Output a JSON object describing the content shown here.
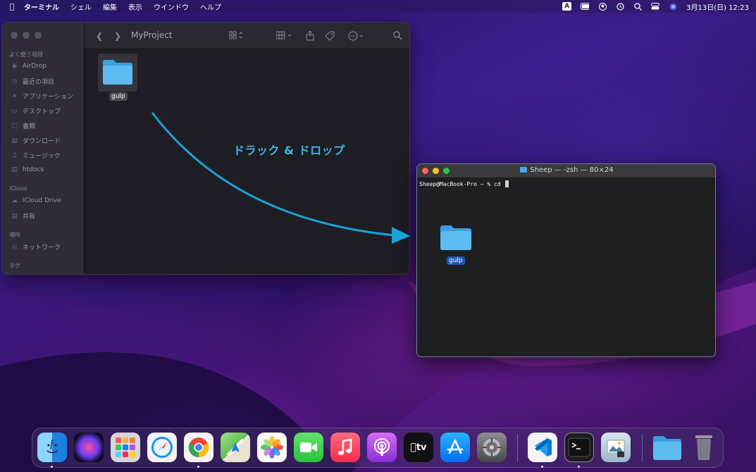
{
  "menubar": {
    "app_name": "ターミナル",
    "items": [
      "シェル",
      "編集",
      "表示",
      "ウインドウ",
      "ヘルプ"
    ],
    "input_mode": "A",
    "datetime": "3月13日(日)  12:23"
  },
  "finder": {
    "title": "MyProject",
    "sidebar": {
      "favorites_header": "よく使う項目",
      "favorites": [
        "AirDrop",
        "最近の項目",
        "アプリケーション",
        "デスクトップ",
        "書類",
        "ダウンロード",
        "ミュージック",
        "htdocs"
      ],
      "icloud_header": "iCloud",
      "icloud": [
        "iCloud Drive",
        "共有"
      ],
      "locations_header": "場所",
      "locations": [
        "ネットワーク"
      ],
      "tags_header": "タグ"
    },
    "items": [
      {
        "name": "gulp"
      }
    ]
  },
  "terminal": {
    "title": "Sheep — -zsh — 80×24",
    "prompt": "Sheep@MacBook-Pro ~ % cd ",
    "dragged_item": "gulp"
  },
  "annotation": {
    "label": "ドラック & ドロップ",
    "color": "#1aa3d9"
  },
  "dock": {
    "apps": [
      "finder",
      "siri",
      "launchpad",
      "safari",
      "chrome",
      "maps",
      "photos",
      "facetime",
      "music",
      "podcasts",
      "tv",
      "app-store",
      "system-preferences",
      "vscode",
      "terminal",
      "preview",
      "downloads-folder",
      "trash"
    ],
    "tv_label": "tv"
  }
}
